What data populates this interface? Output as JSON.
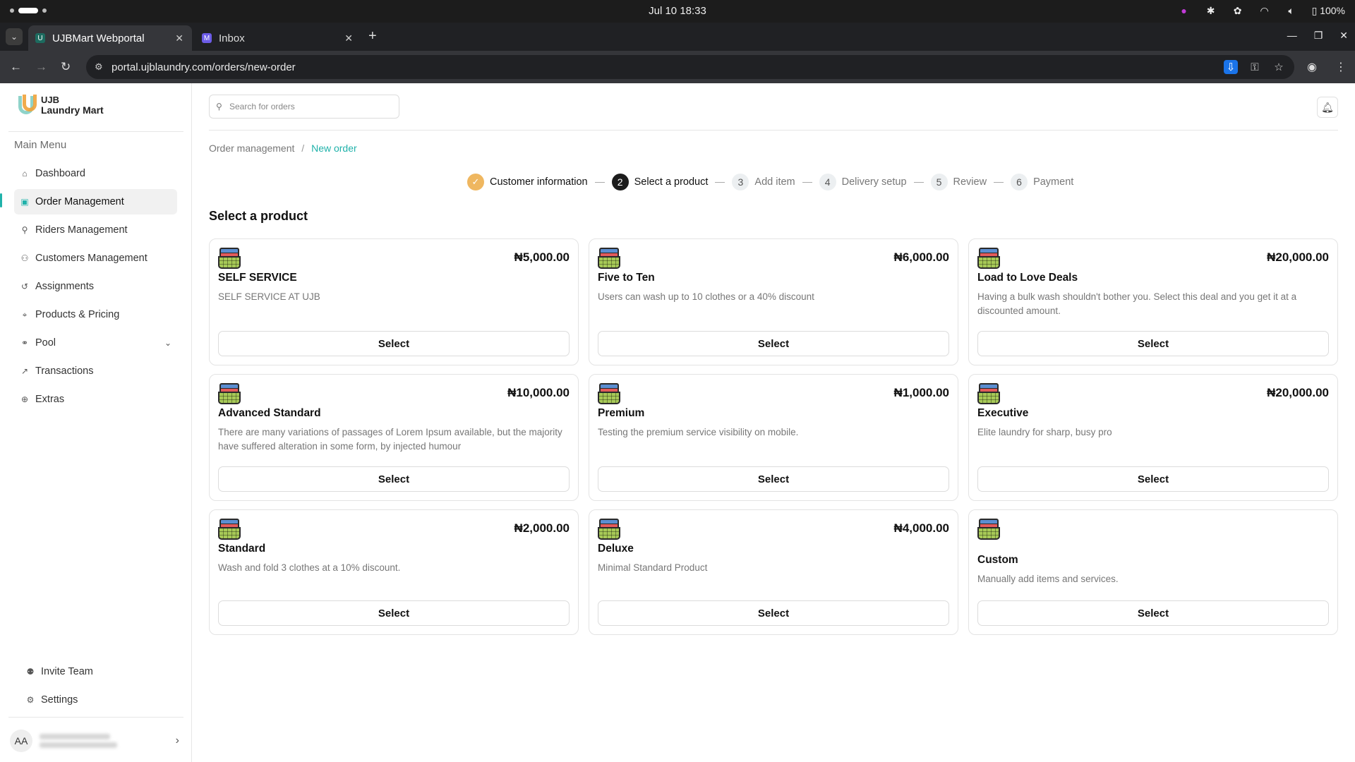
{
  "os": {
    "datetime": "Jul 10  18:33",
    "battery": "100%"
  },
  "browser": {
    "tabs": [
      {
        "title": "UJBMart Webportal",
        "active": true
      },
      {
        "title": "Inbox",
        "active": false
      }
    ],
    "url": "portal.ujblaundry.com/orders/new-order"
  },
  "brand": {
    "line1": "UJB",
    "line2": "Laundry Mart",
    "accent": "#20b2aa"
  },
  "sidebar": {
    "menu_title": "Main Menu",
    "items": [
      {
        "label": "Dashboard",
        "icon": "home-icon"
      },
      {
        "label": "Order Management",
        "icon": "shopping-bag-icon"
      },
      {
        "label": "Riders Management",
        "icon": "bike-icon"
      },
      {
        "label": "Customers Management",
        "icon": "users-icon"
      },
      {
        "label": "Assignments",
        "icon": "history-icon"
      },
      {
        "label": "Products & Pricing",
        "icon": "tag-icon"
      },
      {
        "label": "Pool",
        "icon": "pool-icon"
      },
      {
        "label": "Transactions",
        "icon": "chart-line-icon"
      },
      {
        "label": "Extras",
        "icon": "globe-icon"
      }
    ],
    "bottom": [
      {
        "label": "Invite Team",
        "icon": "user-plus-icon"
      },
      {
        "label": "Settings",
        "icon": "gear-icon"
      }
    ],
    "user_initials": "AA"
  },
  "header": {
    "search_placeholder": "Search for orders"
  },
  "breadcrumb": {
    "parent": "Order management",
    "current": "New order"
  },
  "steps": [
    {
      "num": "✓",
      "label": "Customer information",
      "state": "done"
    },
    {
      "num": "2",
      "label": "Select a product",
      "state": "current"
    },
    {
      "num": "3",
      "label": "Add item",
      "state": "upcoming"
    },
    {
      "num": "4",
      "label": "Delivery setup",
      "state": "upcoming"
    },
    {
      "num": "5",
      "label": "Review",
      "state": "upcoming"
    },
    {
      "num": "6",
      "label": "Payment",
      "state": "upcoming"
    }
  ],
  "section_title": "Select a product",
  "select_label": "Select",
  "products": [
    {
      "name": "SELF SERVICE",
      "price": "₦5,000.00",
      "desc": "SELF SERVICE AT UJB"
    },
    {
      "name": "Five to Ten",
      "price": "₦6,000.00",
      "desc": "Users can wash up to 10 clothes or a 40% discount"
    },
    {
      "name": "Load to Love Deals",
      "price": "₦20,000.00",
      "desc": "Having a bulk wash shouldn't bother you. Select this deal and you get it at a discounted amount."
    },
    {
      "name": "Advanced Standard",
      "price": "₦10,000.00",
      "desc": "There are many variations of passages of Lorem Ipsum available, but the majority have suffered alteration in some form, by injected humour"
    },
    {
      "name": "Premium",
      "price": "₦1,000.00",
      "desc": "Testing the premium service visibility on mobile."
    },
    {
      "name": "Executive",
      "price": "₦20,000.00",
      "desc": "Elite laundry for sharp, busy pro"
    },
    {
      "name": "Standard",
      "price": "₦2,000.00",
      "desc": "Wash and fold 3 clothes at a 10% discount."
    },
    {
      "name": "Deluxe",
      "price": "₦4,000.00",
      "desc": "Minimal Standard Product"
    },
    {
      "name": "Custom",
      "price": "",
      "desc": "Manually add items and services."
    }
  ]
}
